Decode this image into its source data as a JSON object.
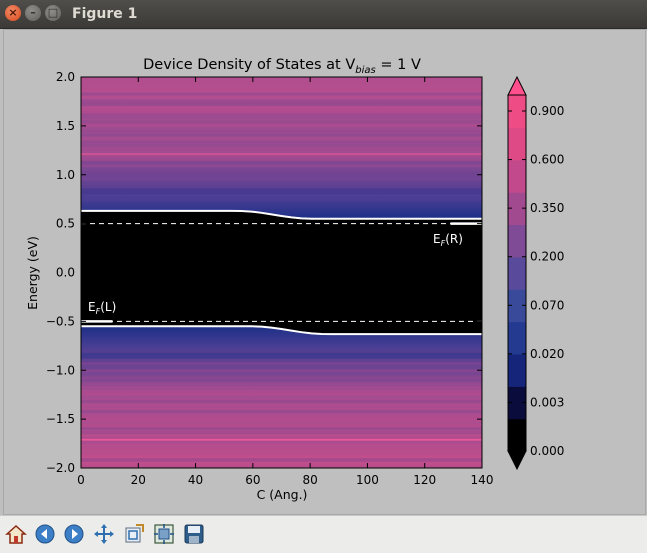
{
  "window": {
    "title": "Figure 1",
    "close_glyph": "×",
    "min_glyph": "–",
    "max_glyph": "□"
  },
  "toolbar": {
    "items": [
      {
        "name": "home-icon"
      },
      {
        "name": "back-arrow-icon"
      },
      {
        "name": "forward-arrow-icon"
      },
      {
        "name": "pan-move-icon"
      },
      {
        "name": "zoom-rectangle-icon"
      },
      {
        "name": "subplots-config-icon"
      },
      {
        "name": "save-floppy-icon"
      }
    ]
  },
  "chart_data": {
    "type": "heatmap",
    "title": {
      "main": "Device Density of States at V",
      "sub": "bias",
      "rest": " = 1 V"
    },
    "xlabel": "C (Ang.)",
    "ylabel": "Energy (eV)",
    "xlim": [
      0,
      140
    ],
    "ylim": [
      -2.0,
      2.0
    ],
    "xticks": [
      0,
      20,
      40,
      60,
      80,
      100,
      120,
      140
    ],
    "yticks": [
      2.0,
      1.5,
      1.0,
      0.5,
      0.0,
      -0.5,
      -1.0,
      -1.5,
      -2.0
    ],
    "ytick_labels": [
      "2.0",
      "1.5",
      "1.0",
      "0.5",
      "0.0",
      "−0.5",
      "−1.0",
      "−1.5",
      "−2.0"
    ],
    "fermi_levels": [
      {
        "label_main": "E",
        "label_sub": "F",
        "label_rest": "(R)",
        "energy": 0.5
      },
      {
        "label_main": "E",
        "label_sub": "F",
        "label_rest": "(L)",
        "energy": -0.5
      }
    ],
    "band_edges": {
      "upper": {
        "left_energy": 0.63,
        "right_energy": 0.55,
        "transition_x": [
          55,
          80
        ]
      },
      "lower": {
        "left_energy": -0.55,
        "right_energy": -0.63,
        "transition_x": [
          60,
          85
        ]
      }
    },
    "colorbar": {
      "ticks": [
        "0.900",
        "0.600",
        "0.350",
        "0.200",
        "0.070",
        "0.020",
        "0.003",
        "0.000"
      ],
      "extend": "both",
      "colors": [
        "#000000",
        "#0a0c3c",
        "#15257a",
        "#243a90",
        "#3a4a9a",
        "#5a4a9c",
        "#7f4a96",
        "#a14a90",
        "#c24a8c",
        "#de4a86",
        "#ee4c84"
      ]
    },
    "grid": false
  }
}
